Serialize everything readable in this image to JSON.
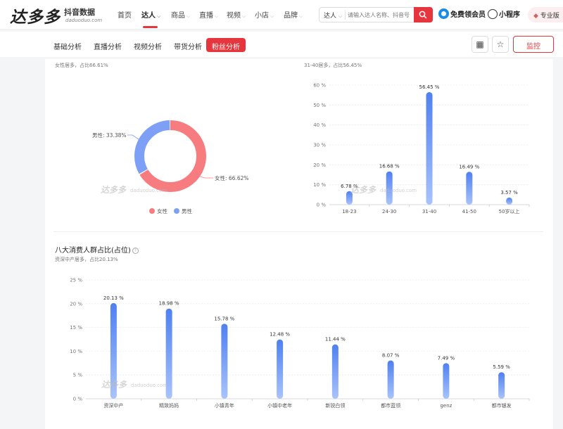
{
  "brand": {
    "name": "达多多",
    "subtitle": "抖音数据",
    "url": "daduoduo.com"
  },
  "nav": {
    "items": [
      {
        "label": "首页",
        "has_caret": false
      },
      {
        "label": "达人",
        "has_caret": true,
        "active": true
      },
      {
        "label": "商品",
        "has_caret": true
      },
      {
        "label": "直播",
        "has_caret": true
      },
      {
        "label": "视频",
        "has_caret": true
      },
      {
        "label": "小店",
        "has_caret": true
      },
      {
        "label": "品牌",
        "has_caret": true
      }
    ]
  },
  "search": {
    "type_label": "达人",
    "placeholder": "请输入达人名称、抖音号"
  },
  "header_links": {
    "vip": "免费领会员",
    "mini_program": "小程序",
    "pro": "专业版"
  },
  "subnav": {
    "tabs": [
      {
        "label": "基础分析"
      },
      {
        "label": "直播分析"
      },
      {
        "label": "视频分析"
      },
      {
        "label": "带货分析"
      },
      {
        "label": "粉丝分析",
        "active": true
      }
    ],
    "monitor_label": "监控"
  },
  "hints": {
    "gender": "女性居多，占比66.61%",
    "age": "31-40居多，占比56.45%",
    "consumer": "资深中产居多，占比20.13%"
  },
  "watermark": {
    "brand": "达多多",
    "url": "daduoduo.com"
  },
  "consumer_section_title": "八大消费人群占比(占位)",
  "colors": {
    "accent": "#e6363d",
    "female": "#f77c7f",
    "male": "#7d9ff6",
    "bar": "#5b8cf5"
  },
  "chart_data": [
    {
      "type": "pie",
      "variant": "donut",
      "slices": [
        {
          "name": "女性",
          "value": 66.62,
          "label": "女性: 66.62%",
          "color": "#f77c7f"
        },
        {
          "name": "男性",
          "value": 33.38,
          "label": "男性: 33.38%",
          "color": "#7d9ff6"
        }
      ],
      "legend": [
        "女性",
        "男性"
      ],
      "legend_position": "bottom"
    },
    {
      "type": "bar",
      "categories": [
        "18-23",
        "24-30",
        "31-40",
        "41-50",
        "50岁以上"
      ],
      "values": [
        6.78,
        16.68,
        56.45,
        16.49,
        3.57
      ],
      "data_labels": [
        "6.78 %",
        "16.68 %",
        "56.45 %",
        "16.49 %",
        "3.57 %"
      ],
      "ylim": [
        0,
        60
      ],
      "yticks": [
        "0 %",
        "10 %",
        "20 %",
        "30 %",
        "40 %",
        "50 %",
        "60 %"
      ],
      "grid": true
    },
    {
      "type": "bar",
      "categories": [
        "资深中产",
        "精致妈妈",
        "小镇青年",
        "小镇中老年",
        "新锐白领",
        "都市蓝领",
        "genz",
        "都市银发"
      ],
      "values": [
        20.13,
        18.98,
        15.78,
        12.48,
        11.44,
        8.07,
        7.49,
        5.59
      ],
      "data_labels": [
        "20.13 %",
        "18.98 %",
        "15.78 %",
        "12.48 %",
        "11.44 %",
        "8.07 %",
        "7.49 %",
        "5.59 %"
      ],
      "ylim": [
        0,
        25
      ],
      "yticks": [
        "0 %",
        "5 %",
        "10 %",
        "15 %",
        "20 %",
        "25 %"
      ],
      "grid": true
    }
  ]
}
